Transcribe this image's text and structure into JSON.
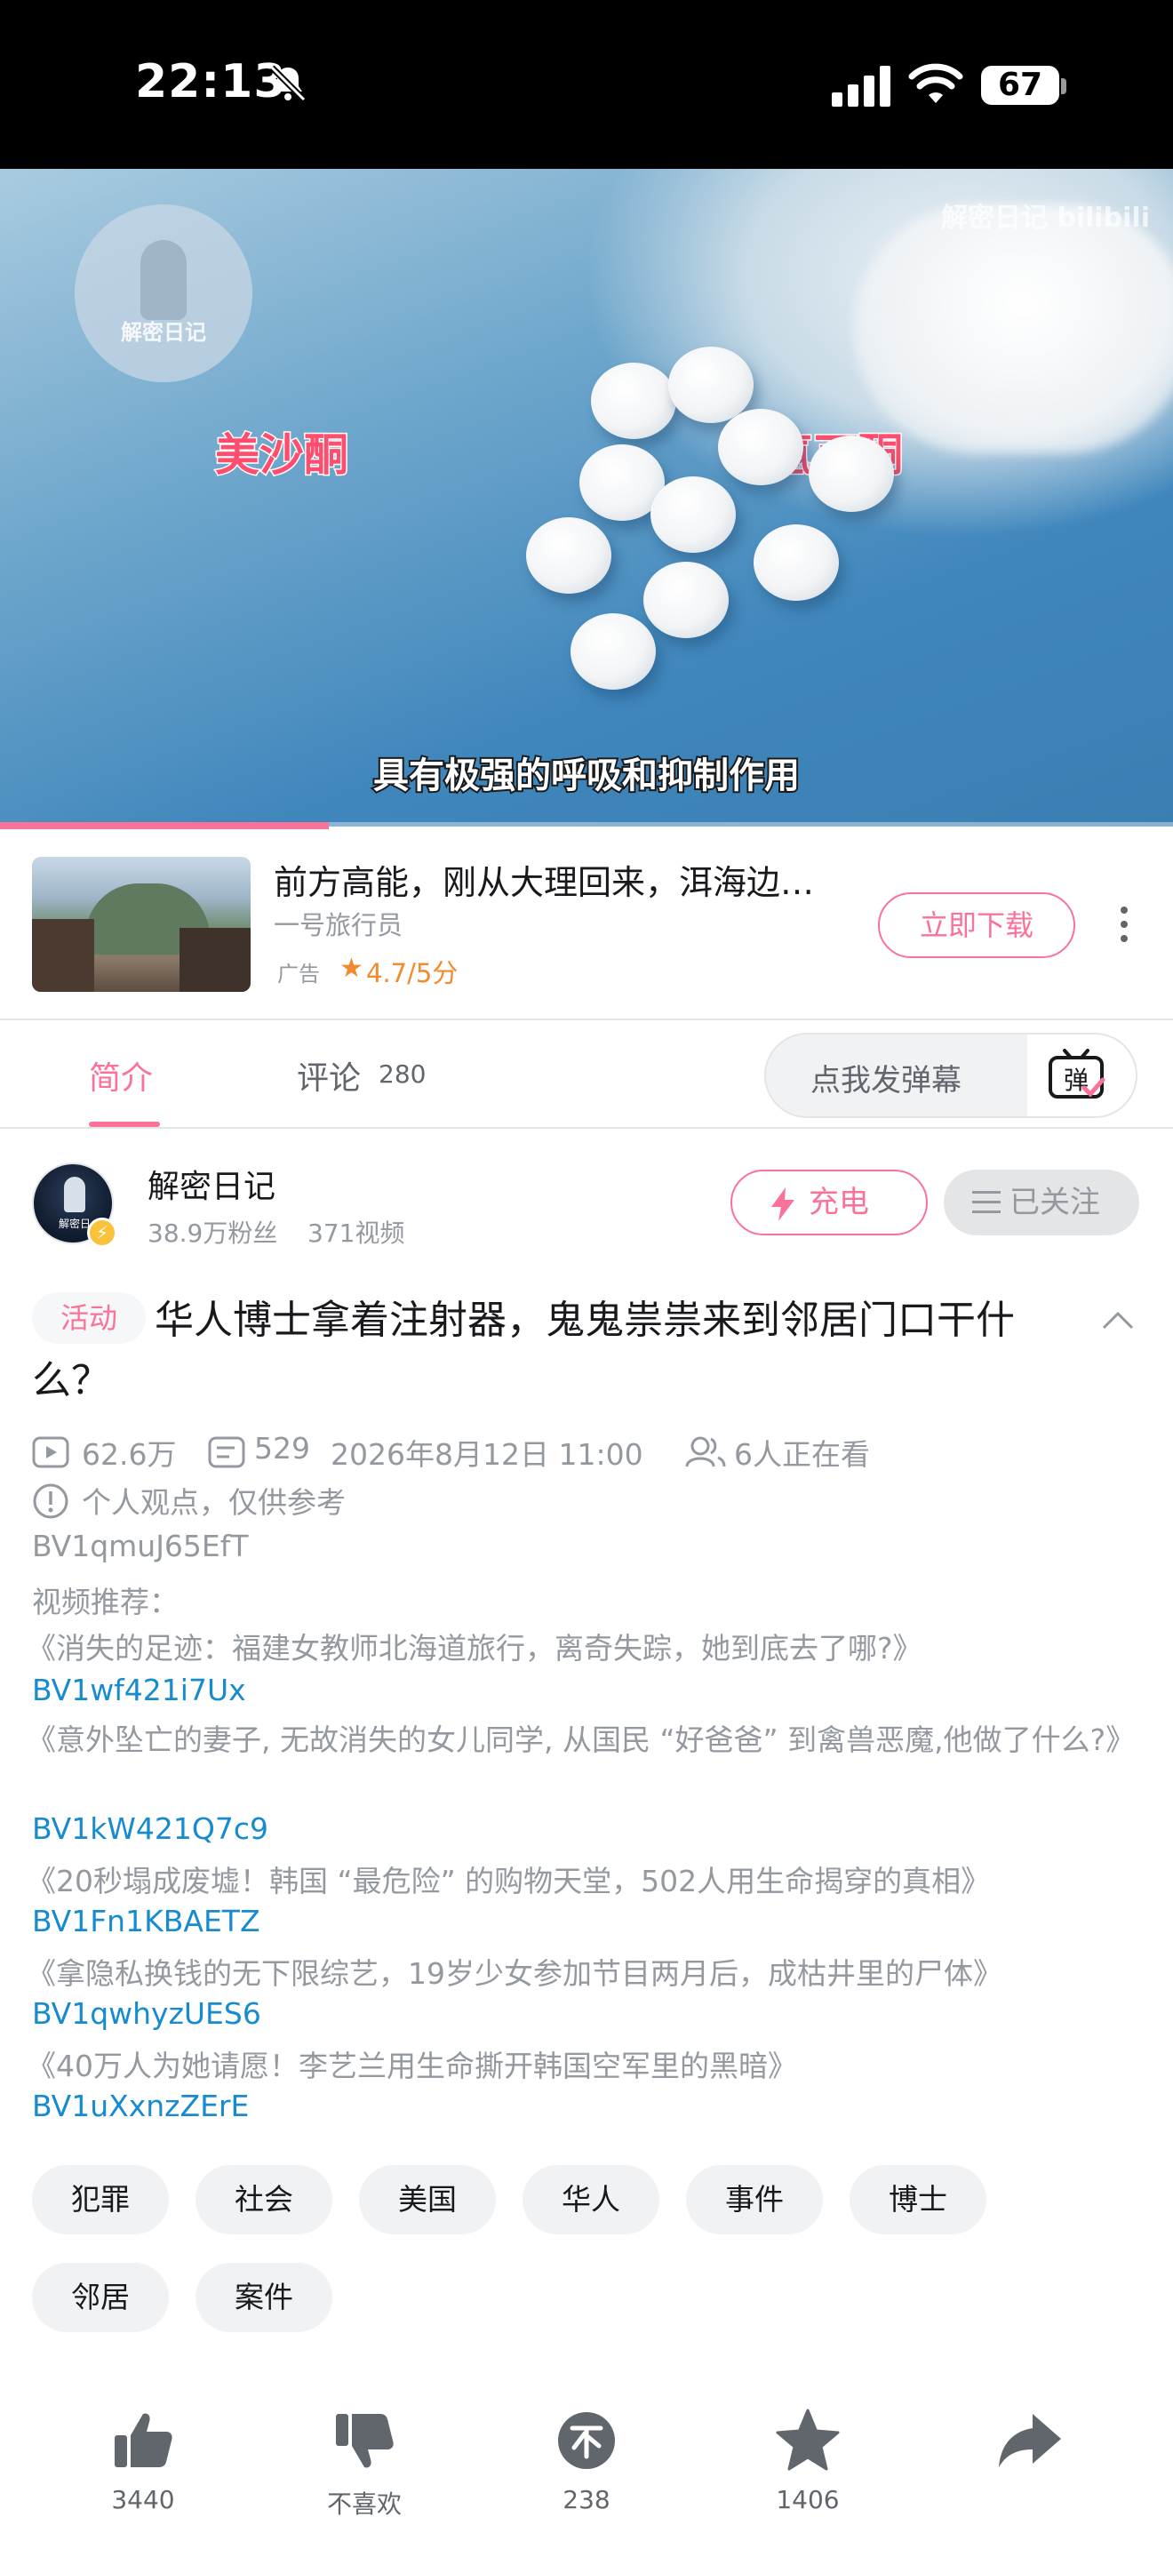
{
  "status_bar": {
    "time": "22:13",
    "battery": "67"
  },
  "player": {
    "watermark_logo_text": "解密日记",
    "watermark_text": "解密日记 bilibili",
    "label_left": "美沙酮",
    "label_right": "氢可酮",
    "subtitle": "具有极强的呼吸和抑制作用",
    "progress_fraction": 0.28
  },
  "ad": {
    "title": "前方高能，刚从大理回来，洱海边…",
    "subtitle": "一号旅行员",
    "tag": "广告",
    "rating": "4.7/5分",
    "button": "立即下载"
  },
  "tabs": {
    "intro": "简介",
    "comments": "评论",
    "comments_count": "280",
    "danmu_placeholder": "点我发弹幕",
    "danmu_icon_char": "弹"
  },
  "uploader": {
    "name": "解密日记",
    "fans": "38.9万粉丝",
    "videos": "371视频",
    "avatar_text": "解密日",
    "charge": "充电",
    "follow": "已关注"
  },
  "video": {
    "activity_badge": "活动",
    "title": "华人博士拿着注射器，鬼鬼祟祟来到邻居门口干什么？",
    "views": "62.6万",
    "danmaku": "529",
    "date": "2026年8月12日 11:00",
    "watching": "6人正在看",
    "notice": "个人观点，仅供参考",
    "bvid": "BV1qmuJ65EfT",
    "recommend_label": "视频推荐：",
    "recommendations": [
      {
        "title": "《消失的足迹：福建女教师北海道旅行，离奇失踪，她到底去了哪?》",
        "bvid": "BV1wf421i7Ux"
      },
      {
        "title": "《意外坠亡的妻子, 无故消失的女儿同学, 从国民 “好爸爸” 到禽兽恶魔,他做了什么?》",
        "bvid": "BV1kW421Q7c9"
      },
      {
        "title": "《20秒塌成废墟！韩国 “最危险” 的购物天堂，502人用生命揭穿的真相》",
        "bvid": "BV1Fn1KBAETZ"
      },
      {
        "title": "《拿隐私换钱的无下限综艺，19岁少女参加节目两月后，成枯井里的尸体》",
        "bvid": "BV1qwhyzUES6"
      },
      {
        "title": "《40万人为她请愿！李艺兰用生命撕开韩国空军里的黑暗》",
        "bvid": "BV1uXxnzZErE"
      }
    ],
    "tags": [
      "犯罪",
      "社会",
      "美国",
      "华人",
      "事件",
      "博士",
      "邻居",
      "案件"
    ]
  },
  "actions": {
    "like": "3440",
    "dislike": "不喜欢",
    "coin": "238",
    "favorite": "1406",
    "share": ""
  },
  "colors": {
    "accent": "#fb7299",
    "link": "#178bcf",
    "muted": "#9499a0",
    "rating": "#f18b2d"
  },
  "icons": [
    "bell-off-icon",
    "signal-icon",
    "wifi-icon",
    "battery-icon",
    "more-icon",
    "danmu-icon",
    "lightning-icon",
    "menu-icon",
    "chevron-up-icon",
    "play-count-icon",
    "danmaku-icon",
    "viewers-icon",
    "info-icon",
    "thumb-up-icon",
    "thumb-down-icon",
    "coin-icon",
    "star-icon",
    "share-icon"
  ]
}
